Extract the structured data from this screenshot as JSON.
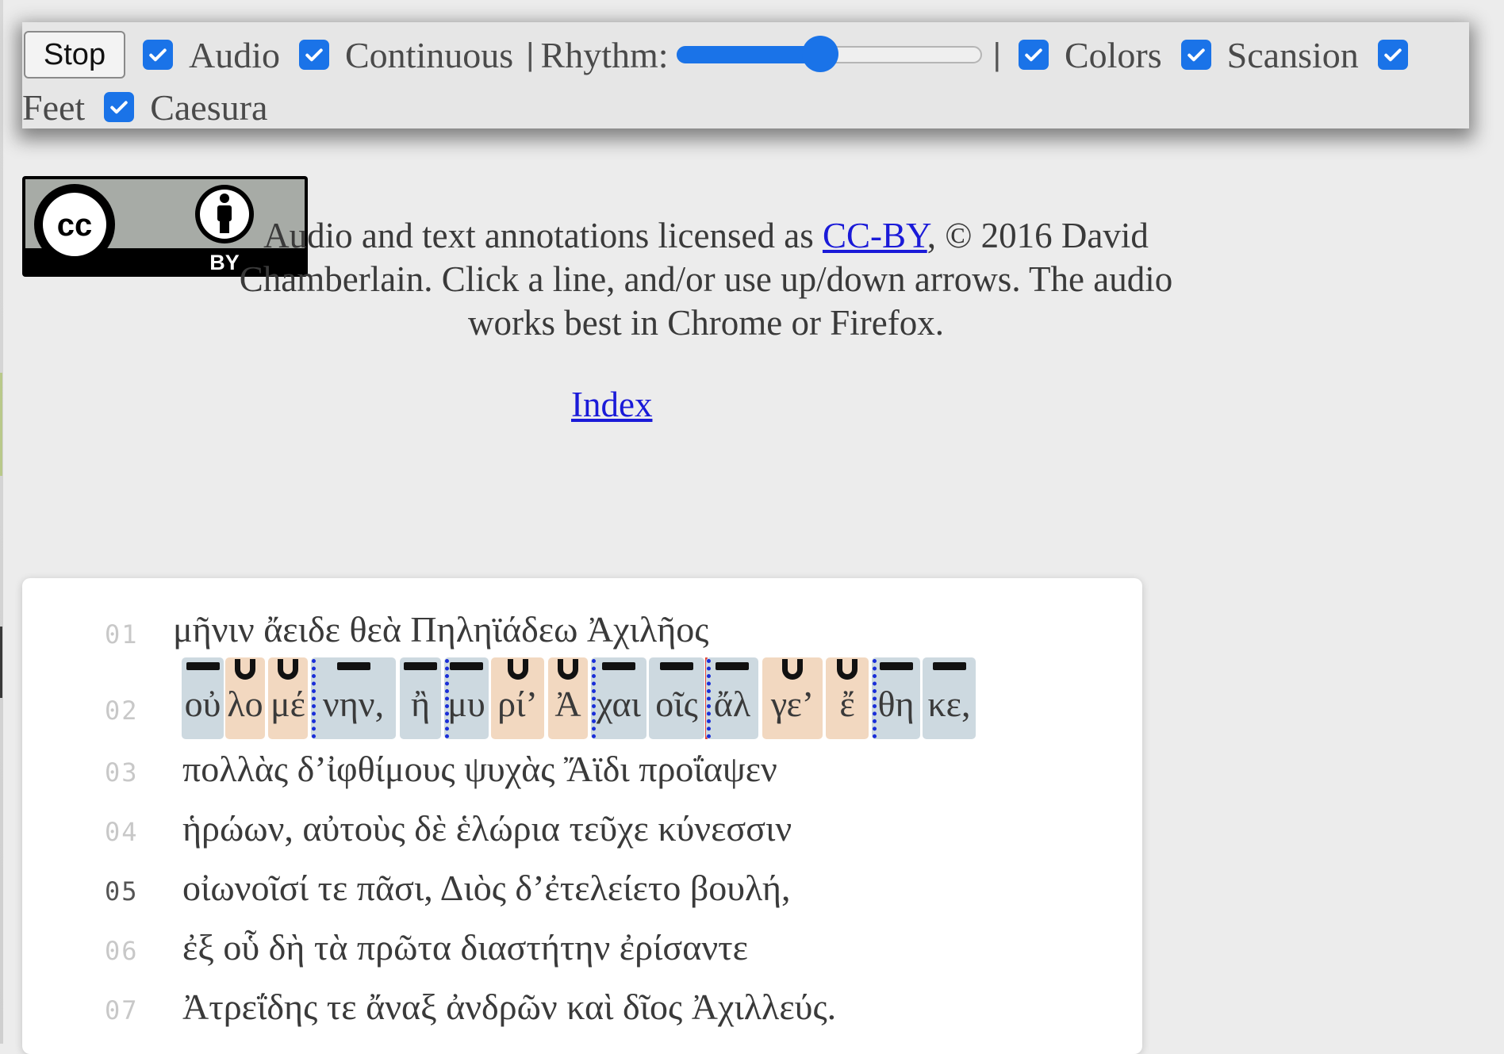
{
  "toolbar": {
    "stop_label": "Stop",
    "options": [
      {
        "label": "Audio",
        "checked": true
      },
      {
        "label": "Continuous",
        "checked": true
      }
    ],
    "separator": "|",
    "rhythm_label": "Rhythm:",
    "rhythm_slider_value": 0.47,
    "options2": [
      {
        "label": "Colors",
        "checked": true
      },
      {
        "label": "Scansion",
        "checked": true
      },
      {
        "label": "Feet",
        "checked": true
      },
      {
        "label": "Caesura",
        "checked": true
      }
    ]
  },
  "license_badge": {
    "icon": "cc-by-icon",
    "text": "BY"
  },
  "intro": {
    "prefix": "Audio and text annotations licensed as ",
    "link": "CC-BY",
    "suffix": ", © 2016 David Chamberlain. Click a line, and/or use up/down arrows. The audio works best in Chrome or Firefox."
  },
  "index_link": "Index",
  "poem": {
    "lines": [
      {
        "num": "01",
        "text": "μῆνιν ἄειδε θεὰ Πηληϊάδεω Ἀχιλῆος"
      },
      {
        "num": "02",
        "text": ""
      },
      {
        "num": "03",
        "text": "πολλὰς δ’ἰφθίμους ψυχὰς Ἄϊδι προΐαψεν"
      },
      {
        "num": "04",
        "text": "ἡρώων, αὐτοὺς δὲ ἑλώρια τεῦχε κύνεσσιν"
      },
      {
        "num": "05",
        "text": "οἰωνοῖσί τε πᾶσι, Διὸς δ’ἐτελείετο βουλή,"
      },
      {
        "num": "06",
        "text": "ἐξ οὗ δὴ τὰ πρῶτα διαστήτην ἐρίσαντε"
      },
      {
        "num": "07",
        "text": "Ἀτρεΐδης τε ἄναξ ἀνδρῶν καὶ δῖος Ἀχιλλεύς."
      }
    ],
    "scanned_line": {
      "num": "02",
      "syllables": [
        {
          "text": "οὐ",
          "q": "long"
        },
        {
          "text": "λο",
          "q": "short"
        },
        {
          "text": "μέ",
          "q": "short"
        },
        {
          "text": "νην,",
          "q": "long"
        },
        {
          "text": "ἢ",
          "q": "long"
        },
        {
          "text": "μυ",
          "q": "long"
        },
        {
          "text": "ρί’",
          "q": "short"
        },
        {
          "text": "Ἀ",
          "q": "short"
        },
        {
          "text": "χαι",
          "q": "long"
        },
        {
          "text": "οῖς",
          "q": "long"
        },
        {
          "text": "ἄλ",
          "q": "long"
        },
        {
          "text": "γε’",
          "q": "short"
        },
        {
          "text": "ἔ",
          "q": "short"
        },
        {
          "text": "θη",
          "q": "long"
        },
        {
          "text": "κε,",
          "q": "long"
        }
      ]
    }
  }
}
